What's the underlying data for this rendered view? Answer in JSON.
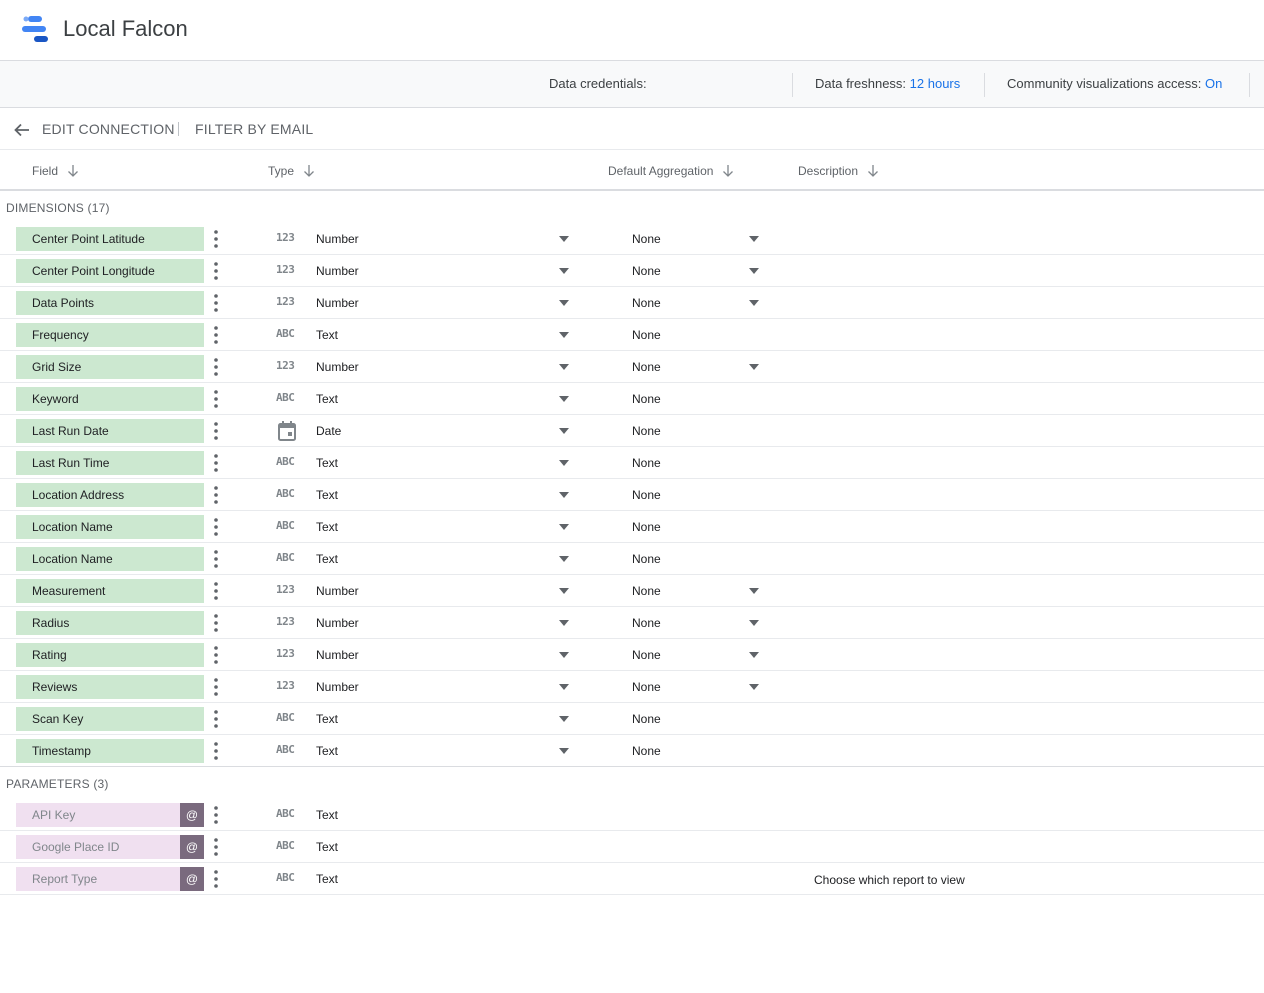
{
  "app": {
    "title": "Local Falcon"
  },
  "info": {
    "credentials_label": "Data credentials:",
    "freshness_label": "Data freshness:",
    "freshness_value": "12 hours",
    "community_label": "Community visualizations access:",
    "community_value": "On"
  },
  "actions": {
    "edit": "EDIT CONNECTION",
    "filter": "FILTER BY EMAIL"
  },
  "columns": {
    "field": "Field",
    "type": "Type",
    "aggregation": "Default Aggregation",
    "description": "Description"
  },
  "sections": {
    "dimensions": "DIMENSIONS (17)",
    "parameters": "PARAMETERS (3)"
  },
  "type_icons": {
    "number": "123",
    "text": "ABC",
    "date": "calendar-icon"
  },
  "colors": {
    "dimension_chip": "#cce8d0",
    "parameter_chip": "#f0e0f0",
    "link": "#1a73e8"
  },
  "dimensions": [
    {
      "field": "Center Point Latitude",
      "type": "Number",
      "icon": "123",
      "aggregation": "None",
      "agg_dropdown": true
    },
    {
      "field": "Center Point Longitude",
      "type": "Number",
      "icon": "123",
      "aggregation": "None",
      "agg_dropdown": true
    },
    {
      "field": "Data Points",
      "type": "Number",
      "icon": "123",
      "aggregation": "None",
      "agg_dropdown": true
    },
    {
      "field": "Frequency",
      "type": "Text",
      "icon": "ABC",
      "aggregation": "None",
      "agg_dropdown": false
    },
    {
      "field": "Grid Size",
      "type": "Number",
      "icon": "123",
      "aggregation": "None",
      "agg_dropdown": true
    },
    {
      "field": "Keyword",
      "type": "Text",
      "icon": "ABC",
      "aggregation": "None",
      "agg_dropdown": false
    },
    {
      "field": "Last Run Date",
      "type": "Date",
      "icon": "date",
      "aggregation": "None",
      "agg_dropdown": false
    },
    {
      "field": "Last Run Time",
      "type": "Text",
      "icon": "ABC",
      "aggregation": "None",
      "agg_dropdown": false
    },
    {
      "field": "Location Address",
      "type": "Text",
      "icon": "ABC",
      "aggregation": "None",
      "agg_dropdown": false
    },
    {
      "field": "Location Name",
      "type": "Text",
      "icon": "ABC",
      "aggregation": "None",
      "agg_dropdown": false
    },
    {
      "field": "Location Name",
      "type": "Text",
      "icon": "ABC",
      "aggregation": "None",
      "agg_dropdown": false
    },
    {
      "field": "Measurement",
      "type": "Number",
      "icon": "123",
      "aggregation": "None",
      "agg_dropdown": true
    },
    {
      "field": "Radius",
      "type": "Number",
      "icon": "123",
      "aggregation": "None",
      "agg_dropdown": true
    },
    {
      "field": "Rating",
      "type": "Number",
      "icon": "123",
      "aggregation": "None",
      "agg_dropdown": true
    },
    {
      "field": "Reviews",
      "type": "Number",
      "icon": "123",
      "aggregation": "None",
      "agg_dropdown": true
    },
    {
      "field": "Scan Key",
      "type": "Text",
      "icon": "ABC",
      "aggregation": "None",
      "agg_dropdown": false
    },
    {
      "field": "Timestamp",
      "type": "Text",
      "icon": "ABC",
      "aggregation": "None",
      "agg_dropdown": false
    }
  ],
  "parameters": [
    {
      "field": "API Key",
      "type": "Text",
      "icon": "ABC",
      "badge": "@",
      "description": ""
    },
    {
      "field": "Google Place ID",
      "type": "Text",
      "icon": "ABC",
      "badge": "@",
      "description": ""
    },
    {
      "field": "Report Type",
      "type": "Text",
      "icon": "ABC",
      "badge": "@",
      "description": "Choose which report to view"
    }
  ]
}
